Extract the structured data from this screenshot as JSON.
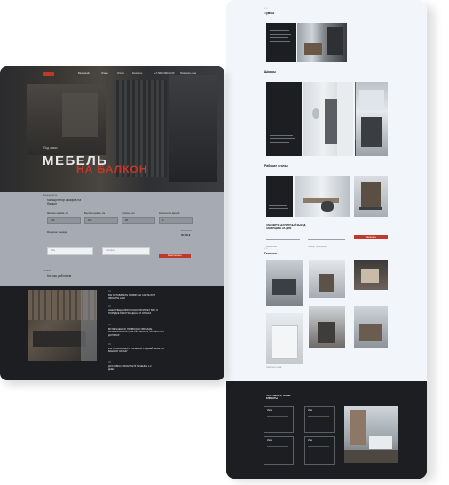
{
  "left_page": {
    "nav_items": [
      "Ваш шкаф",
      "Этапы",
      "Услуги",
      "Контакты"
    ],
    "phone": "+7 (999) 000-00-00",
    "callback": "Позвонить мне",
    "hero": {
      "kicker": "Под заказ",
      "title_line1": "МЕБЕЛЬ",
      "title_line2": "НА БАЛКОН"
    },
    "calc": {
      "kicker": "Калькулятор",
      "title": "Калькулятор шкафов на балкон",
      "labels": [
        "Ширина проёма, см",
        "Высота проёма, см",
        "Глубина, см",
        "Количество дверей"
      ],
      "values": [
        "100",
        "220",
        "45",
        "2"
      ],
      "material_label": "Материал фасада",
      "price_label": "Стоимость",
      "price": "00 000 ₽",
      "name_placeholder": "Имя",
      "phone_placeholder": "Телефон",
      "submit": "Рассчитать"
    },
    "steps": {
      "kicker": "Этапы",
      "title": "Как мы работаем",
      "items": [
        {
          "num": "01",
          "text": "ВЫ ОСТАВЛЯЕТЕ ЗАЯВКУ НА САЙТЕ ИЛИ ЗВОНИТЕ НАМ"
        },
        {
          "num": "02",
          "text": "НАШ СПЕЦИАЛИСТ КОНСУЛЬТИРУЕТ ВАС О ПОРЯДКЕ РАБОТЫ, ЦЕНАХ И СРОКАХ"
        },
        {
          "num": "03",
          "text": "ВСТРЕЧАЕМСЯ, ПРИВОЗИМ ОБРАЗЦЫ, РАЗРАБАТЫВАЕМ ДИЗАЙН-ПРОЕКТ, ЗАКЛЮЧАЕМ ДОГОВОР"
        },
        {
          "num": "04",
          "text": "ИЗГОТАВЛИВАЕМ В ТЕЧЕНИЕ 5-6 ДНЕЙ ШКАФ ПО ВАШЕМУ ЗАКАЗУ"
        },
        {
          "num": "05",
          "text": "ДОСТАВКА И МОНТАЖ В ТЕЧЕНИЕ 1-2 ДНЕЙ"
        }
      ]
    }
  },
  "right_page": {
    "sec1": {
      "title": "Тумбы"
    },
    "sec2": {
      "title": "Шкафы"
    },
    "sec3": {
      "title": "Рабочие столы"
    },
    "form": {
      "title": "ЗАКАЖИТЕ БЕСПЛАТНЫЙ ВЫЕЗД ЗАМЕРЩИКА НА ДОМ",
      "name_placeholder": "Ваше имя",
      "phone_placeholder": "Номер телефона",
      "submit": "Заказать"
    },
    "gallery": {
      "title": "Галерея",
      "more": "Смотреть ещё"
    },
    "footer": {
      "title": "ЧТО ГОВОРЯТ НАШИ КЛИЕНТЫ",
      "review_name": "Имя"
    }
  },
  "colors": {
    "dark": "#1c1e22",
    "accent": "#c0392b",
    "light_bg": "#f2f6fa"
  }
}
